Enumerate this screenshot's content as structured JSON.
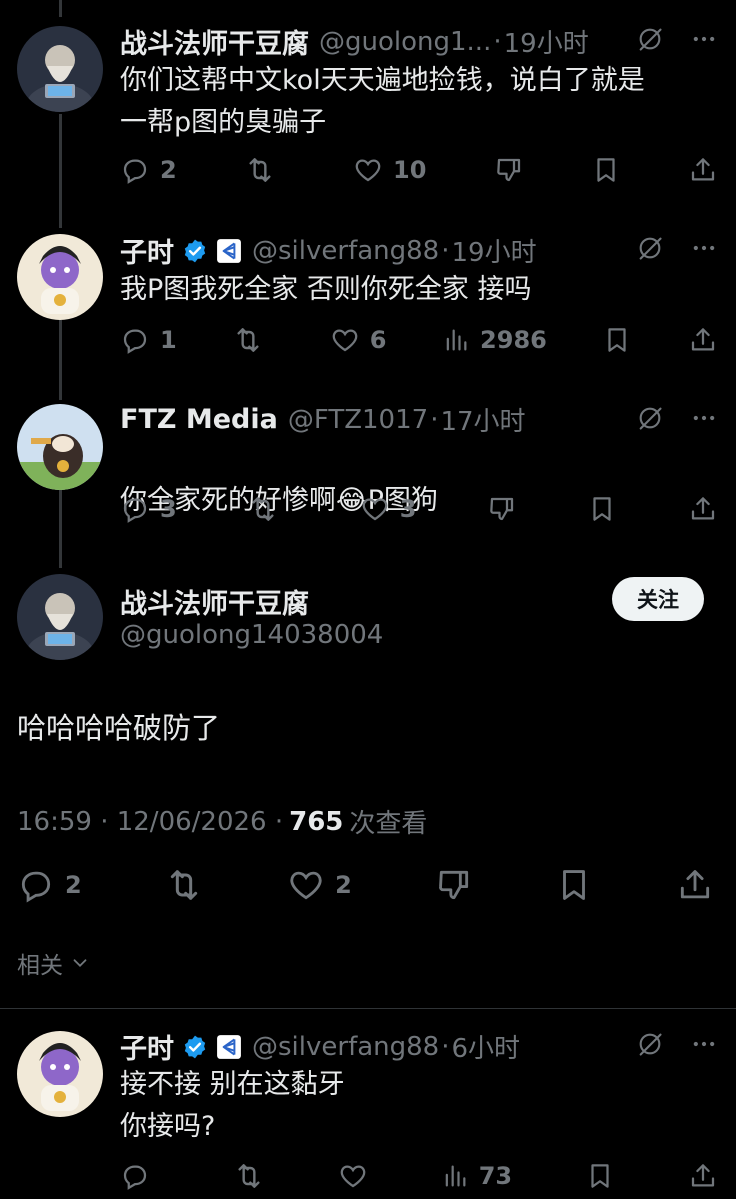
{
  "tweets": [
    {
      "name": "战斗法师干豆腐",
      "handle": "@guolong1...",
      "sep": "·",
      "time": "19小时",
      "text": "你们这帮中文kol天天遍地捡钱，说白了就是\n一帮p图的臭骗子",
      "replies": "2",
      "retweets": "",
      "likes": "10",
      "views": ""
    },
    {
      "name": "子时",
      "handle": "@silverfang88",
      "sep": "·",
      "time": "19小时",
      "text": "我P图我死全家  否则你死全家 接吗",
      "replies": "1",
      "retweets": "",
      "likes": "6",
      "views": "2986"
    },
    {
      "name": "FTZ Media",
      "handle": "@FTZ1017",
      "sep": "·",
      "time": "17小时",
      "text_before": "你全家死的好惨啊",
      "emoji": "😂",
      "text_after": "P图狗",
      "replies": "3",
      "retweets": "",
      "likes": "3",
      "views": ""
    }
  ],
  "main_tweet": {
    "name": "战斗法师干豆腐",
    "handle": "@guolong14038004",
    "follow_label": "关注",
    "text": "哈哈哈哈破防了",
    "timestamp": "16:59 · 12/06/2026 ·",
    "views_count": "765",
    "views_label": "次查看",
    "replies": "2",
    "likes": "2"
  },
  "related_label": "相关",
  "reply_tweet": {
    "name": "子时",
    "handle": "@silverfang88",
    "sep": "·",
    "time": "6小时",
    "text": "接不接 别在这黏牙\n你接吗?",
    "replies": "",
    "views": "73"
  },
  "colors": {
    "verified_blue": "#1d9bf0",
    "muted": "#71767b",
    "text": "#e7e9ea"
  }
}
